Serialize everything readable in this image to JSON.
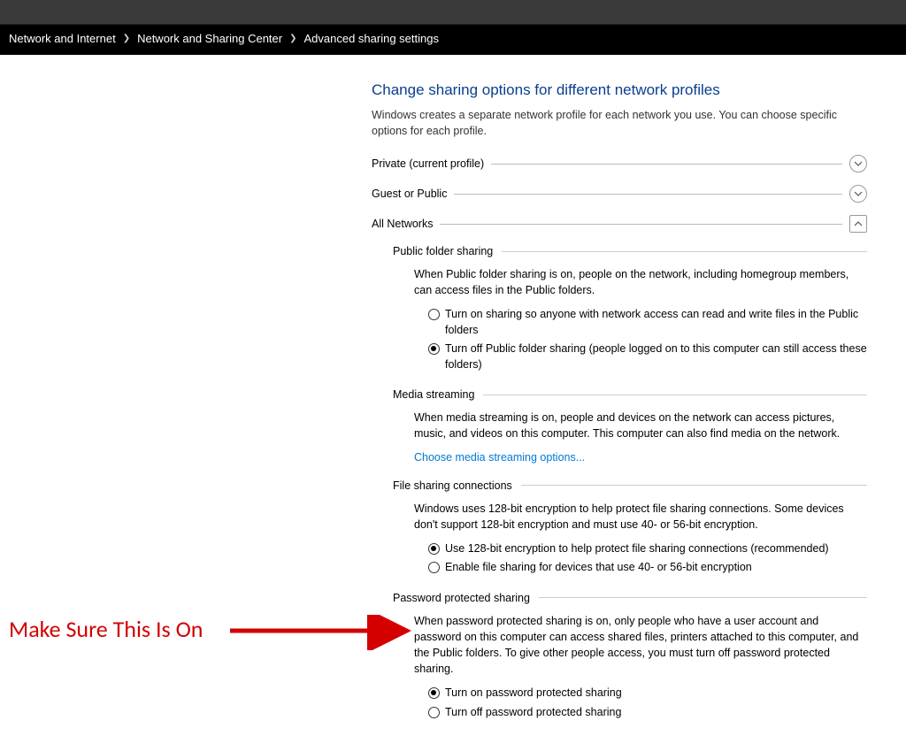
{
  "breadcrumb": {
    "items": [
      "Network and Internet",
      "Network and Sharing Center",
      "Advanced sharing settings"
    ]
  },
  "page": {
    "title": "Change sharing options for different network profiles",
    "intro": "Windows creates a separate network profile for each network you use. You can choose specific options for each profile."
  },
  "profiles": {
    "private_label": "Private (current profile)",
    "guest_label": "Guest or Public",
    "all_label": "All Networks"
  },
  "public_folder": {
    "header": "Public folder sharing",
    "desc": "When Public folder sharing is on, people on the network, including homegroup members, can access files in the Public folders.",
    "opt_on": "Turn on sharing so anyone with network access can read and write files in the Public folders",
    "opt_off": "Turn off Public folder sharing (people logged on to this computer can still access these folders)",
    "selected": "off"
  },
  "media": {
    "header": "Media streaming",
    "desc": "When media streaming is on, people and devices on the network can access pictures, music, and videos on this computer. This computer can also find media on the network.",
    "link": "Choose media streaming options..."
  },
  "encryption": {
    "header": "File sharing connections",
    "desc": "Windows uses 128-bit encryption to help protect file sharing connections. Some devices don't support 128-bit encryption and must use 40- or 56-bit encryption.",
    "opt_128": "Use 128-bit encryption to help protect file sharing connections (recommended)",
    "opt_40": "Enable file sharing for devices that use 40- or 56-bit encryption",
    "selected": "128"
  },
  "password": {
    "header": "Password protected sharing",
    "desc": "When password protected sharing is on, only people who have a user account and password on this computer can access shared files, printers attached to this computer, and the Public folders. To give other people access, you must turn off password protected sharing.",
    "opt_on": "Turn on password protected sharing",
    "opt_off": "Turn off password protected sharing",
    "selected": "on"
  },
  "annotation": {
    "text": "Make Sure This Is On"
  }
}
